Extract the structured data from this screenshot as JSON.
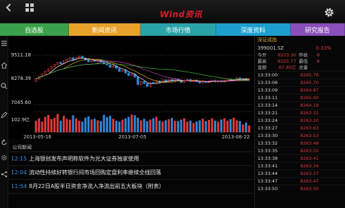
{
  "header": {
    "logo": "Wind资讯"
  },
  "tabs": [
    {
      "label": "自选股",
      "color": "#3aa24a"
    },
    {
      "label": "新闻资讯",
      "color": "#e8a12a"
    },
    {
      "label": "市场行情",
      "color": "#2aa3a8"
    },
    {
      "label": "深度资料",
      "color": "#1d9fce"
    },
    {
      "label": "研究报告",
      "color": "#8a4fb8"
    }
  ],
  "chart_data": {
    "type": "candlestick",
    "price_ticks": [
      "9511.18",
      "8278.39",
      "7045.60"
    ],
    "volume_label": "102.9亿",
    "date_ticks": [
      "2013-05-16",
      "2013-07-05",
      "2013-08-22"
    ],
    "ylim": [
      7045.6,
      9511.18
    ],
    "candles": [
      {
        "o": 8200,
        "c": 8330
      },
      {
        "o": 8330,
        "c": 8450
      },
      {
        "o": 8450,
        "c": 8560
      },
      {
        "o": 8560,
        "c": 8700
      },
      {
        "o": 8700,
        "c": 8820
      },
      {
        "o": 8820,
        "c": 8950
      },
      {
        "o": 8950,
        "c": 9050
      },
      {
        "o": 9050,
        "c": 9150
      },
      {
        "o": 9150,
        "c": 9080
      },
      {
        "o": 9080,
        "c": 9230
      },
      {
        "o": 9230,
        "c": 9300
      },
      {
        "o": 9300,
        "c": 9380
      },
      {
        "o": 9380,
        "c": 9270
      },
      {
        "o": 9270,
        "c": 9380
      },
      {
        "o": 9380,
        "c": 9450
      },
      {
        "o": 9450,
        "c": 9360
      },
      {
        "o": 9360,
        "c": 9260
      },
      {
        "o": 9260,
        "c": 9180
      },
      {
        "o": 9180,
        "c": 9260
      },
      {
        "o": 9260,
        "c": 9200
      },
      {
        "o": 9200,
        "c": 9280
      },
      {
        "o": 9280,
        "c": 9180
      },
      {
        "o": 9180,
        "c": 9080
      },
      {
        "o": 9080,
        "c": 9020
      },
      {
        "o": 9020,
        "c": 8900
      },
      {
        "o": 8900,
        "c": 8960
      },
      {
        "o": 8960,
        "c": 8850
      },
      {
        "o": 8850,
        "c": 8700
      },
      {
        "o": 8700,
        "c": 8760
      },
      {
        "o": 8760,
        "c": 8620
      },
      {
        "o": 8620,
        "c": 8500
      },
      {
        "o": 8500,
        "c": 8560
      },
      {
        "o": 8560,
        "c": 8420
      },
      {
        "o": 8420,
        "c": 8050
      },
      {
        "o": 8050,
        "c": 8200
      },
      {
        "o": 8200,
        "c": 8100
      },
      {
        "o": 8100,
        "c": 7950
      },
      {
        "o": 7950,
        "c": 8150
      },
      {
        "o": 8150,
        "c": 8100
      },
      {
        "o": 8100,
        "c": 8230
      },
      {
        "o": 8230,
        "c": 8150
      },
      {
        "o": 8150,
        "c": 8280
      },
      {
        "o": 8280,
        "c": 8180
      },
      {
        "o": 8180,
        "c": 8300
      },
      {
        "o": 8300,
        "c": 8220
      },
      {
        "o": 8220,
        "c": 8320
      },
      {
        "o": 8320,
        "c": 8250
      },
      {
        "o": 8250,
        "c": 8150
      },
      {
        "o": 8150,
        "c": 8250
      },
      {
        "o": 8250,
        "c": 8300
      },
      {
        "o": 8300,
        "c": 8200
      },
      {
        "o": 8200,
        "c": 8270
      },
      {
        "o": 8270,
        "c": 8180
      },
      {
        "o": 8180,
        "c": 8120
      },
      {
        "o": 8120,
        "c": 8200
      },
      {
        "o": 8200,
        "c": 8150
      },
      {
        "o": 8150,
        "c": 8220
      },
      {
        "o": 8220,
        "c": 8260
      },
      {
        "o": 8260,
        "c": 8180
      },
      {
        "o": 8180,
        "c": 8240
      },
      {
        "o": 8240,
        "c": 8180
      },
      {
        "o": 8180,
        "c": 8250
      },
      {
        "o": 8250,
        "c": 8320
      },
      {
        "o": 8320,
        "c": 8250
      },
      {
        "o": 8250,
        "c": 8300
      },
      {
        "o": 8300,
        "c": 8380
      },
      {
        "o": 8380,
        "c": 8300
      },
      {
        "o": 8300,
        "c": 8340
      },
      {
        "o": 8340,
        "c": 8260
      },
      {
        "o": 8260,
        "c": 8310
      }
    ],
    "ma_series": [
      {
        "name": "MA5",
        "color": "#ffffff"
      },
      {
        "name": "MA10",
        "color": "#e8b020"
      },
      {
        "name": "MA20",
        "color": "#d040c0"
      },
      {
        "name": "MA60",
        "color": "#40c040"
      }
    ],
    "volumes": [
      60,
      72,
      55,
      80,
      90,
      68,
      75,
      95,
      60,
      85,
      70,
      65,
      88,
      72,
      60,
      55,
      75,
      82,
      66,
      70,
      62,
      58,
      90,
      78,
      85,
      70,
      60,
      55,
      66,
      72,
      80,
      92,
      88,
      75,
      62,
      70,
      58,
      66,
      72,
      80,
      60,
      55,
      62,
      68,
      74,
      60,
      58,
      66,
      72,
      55,
      60,
      48,
      56,
      62,
      70,
      58,
      64,
      72,
      60,
      55,
      66,
      72,
      60,
      68,
      75,
      62,
      58,
      40,
      50,
      35
    ]
  },
  "news": {
    "header": "公司新闻",
    "items": [
      {
        "time": "12:15",
        "title": "上海银创发布声明称软件为光大证券独家使用"
      },
      {
        "time": "12:04",
        "title": "流动性持续好转银行间市场回购定盘利率继续全线回落"
      },
      {
        "time": "11:54",
        "title": "8月22日A股半日资金净流入净流出前五大板块（附表）"
      }
    ]
  },
  "quote": {
    "title": "深证成指",
    "code": "399001.SZ",
    "change_pct": "0.33%",
    "rows": [
      {
        "l1": "今开",
        "v1": "8223.30",
        "l2": "昨收",
        "v2": "8"
      },
      {
        "l1": "最高",
        "v1": "8325.77",
        "l2": "最低",
        "v2": "8"
      },
      {
        "l1": "金额",
        "v1": "67.85亿",
        "l2": "总量",
        "v2": ""
      }
    ],
    "ticks": [
      {
        "time": "13:33:00",
        "price": "8265.76"
      },
      {
        "time": "13:33:06",
        "price": "8265.70"
      },
      {
        "time": "13:33:09",
        "price": "8264.87"
      },
      {
        "time": "13:33:11",
        "price": "8265.00"
      },
      {
        "time": "13:33:14",
        "price": "8264.18"
      },
      {
        "time": "13:33:21",
        "price": "8263.31"
      },
      {
        "time": "13:33:24",
        "price": "8263.20"
      },
      {
        "time": "13:33:27",
        "price": "8263.63"
      },
      {
        "time": "13:33:30",
        "price": "8263.53"
      },
      {
        "time": "13:33:32",
        "price": "8263.48"
      },
      {
        "time": "13:33:35",
        "price": "8263.55"
      },
      {
        "time": "13:33:38",
        "price": "8263.41"
      },
      {
        "time": "13:33:41",
        "price": "8263.34"
      },
      {
        "time": "13:33:44",
        "price": "8263.37"
      },
      {
        "time": "13:33:47",
        "price": "8263.47"
      },
      {
        "time": "13:33:50",
        "price": "8263.50"
      }
    ]
  }
}
